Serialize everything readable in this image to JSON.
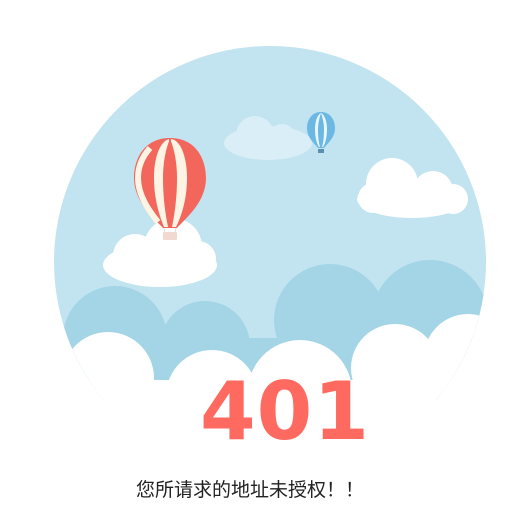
{
  "error": {
    "code": "401",
    "message": "您所请求的地址未授权！！"
  },
  "colors": {
    "code": "#ff6a60",
    "sky": "#c2e4f0",
    "hills": "#a3d5e6",
    "cloud": "#ffffff",
    "balloon_red": "#f2665c",
    "balloon_cream": "#fdf4e4",
    "balloon_blue": "#6bb8e3"
  },
  "icons": {
    "large_balloon": "hot-air-balloon-icon",
    "small_balloon": "hot-air-balloon-icon"
  }
}
